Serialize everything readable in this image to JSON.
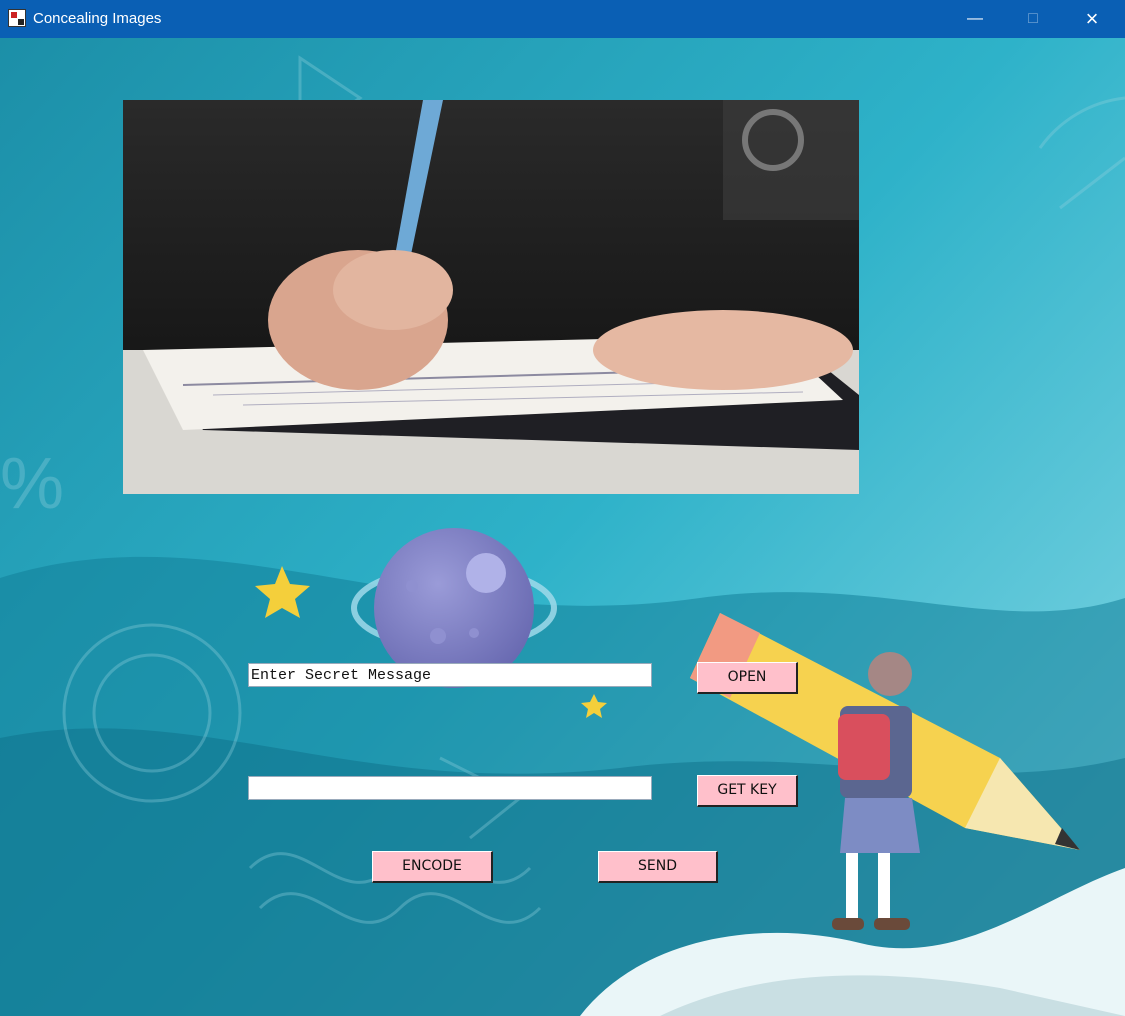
{
  "window": {
    "title": "Concealing Images",
    "controls": [
      "minimize-icon",
      "maximize-icon",
      "close-icon"
    ]
  },
  "form": {
    "secret_message_value": "Enter Secret Message",
    "key_value": "",
    "open_label": "OPEN",
    "get_key_label": "GET KEY",
    "encode_label": "ENCODE",
    "send_label": "SEND"
  },
  "colors": {
    "titlebar": "#0a5fb4",
    "button_bg": "#ffc0cb",
    "background": "#1aa3bf"
  }
}
